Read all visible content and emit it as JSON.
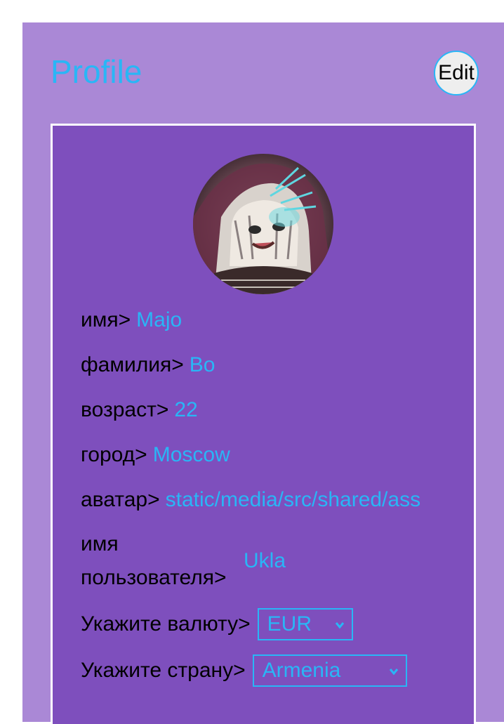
{
  "header": {
    "title": "Profile",
    "edit_label": "Edit"
  },
  "profile": {
    "fields": [
      {
        "label": "имя>",
        "value": "Majo"
      },
      {
        "label": "фамилия>",
        "value": "Bo"
      },
      {
        "label": "возраст>",
        "value": "22"
      },
      {
        "label": "город>",
        "value": "Moscow"
      },
      {
        "label": "аватар>",
        "value": "static/media/src/shared/ass"
      },
      {
        "label": "имя пользователя>",
        "value": "Ukla"
      }
    ],
    "currency": {
      "label": "Укажите валюту>",
      "selected": "EUR"
    },
    "country": {
      "label": "Укажите страну>",
      "selected": "Armenia"
    }
  },
  "colors": {
    "accent": "#29b6f6",
    "page_bg": "#aa88d6",
    "card_bg": "#7e4fbd"
  },
  "icons": {
    "select_arrow": "chevron-down-icon"
  }
}
